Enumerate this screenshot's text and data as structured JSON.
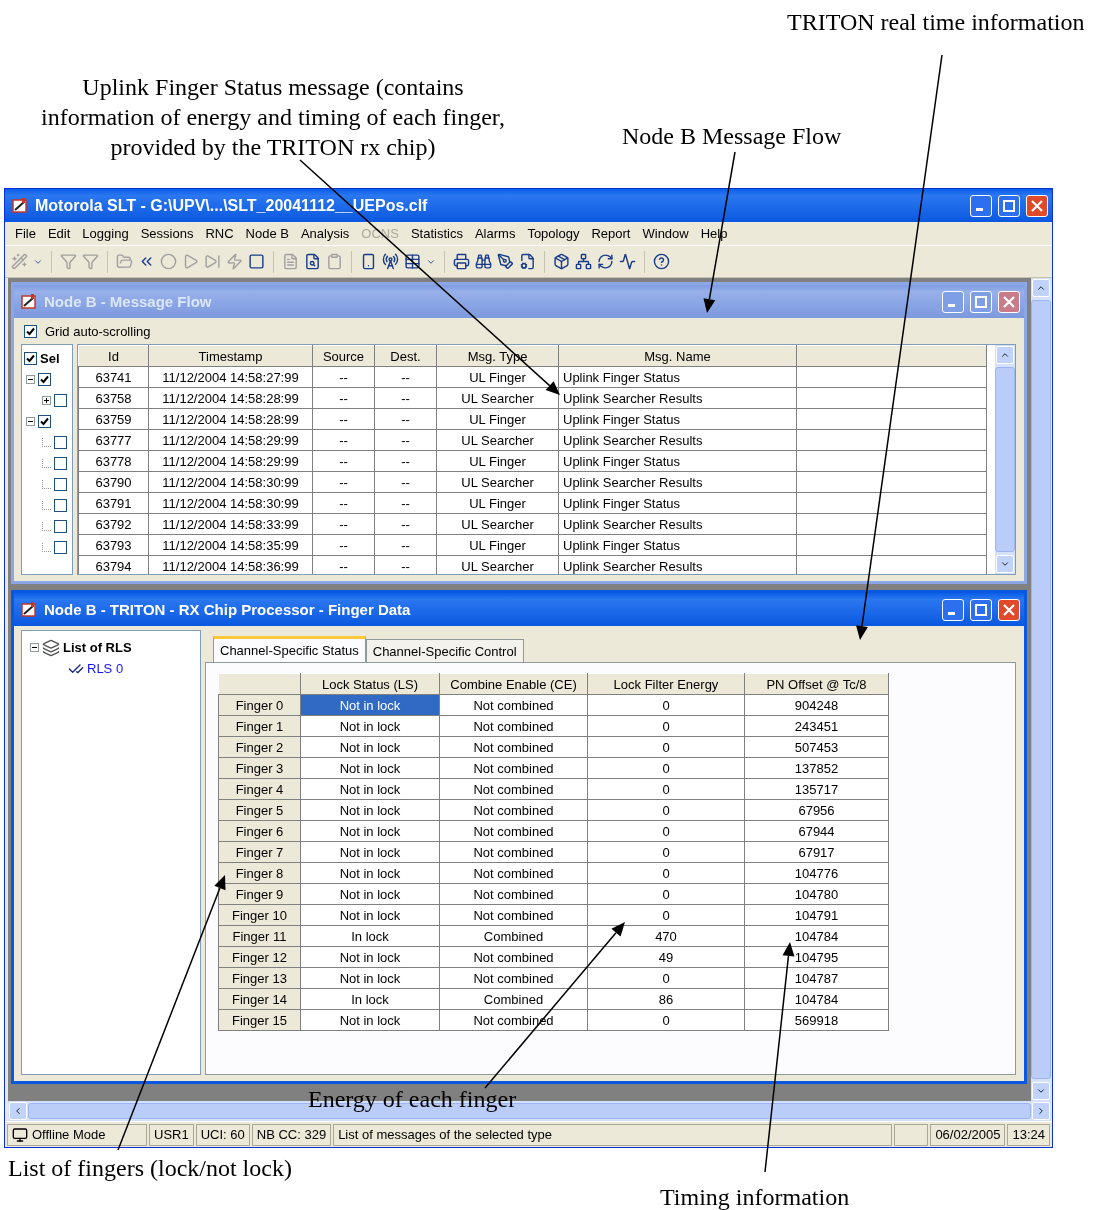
{
  "annotations": [
    {
      "text": "Uplink Finger Status message (contains\ninformation of energy and timing of each finger,\nprovided by the TRITON rx chip)"
    },
    {
      "text": "Node B Message Flow"
    },
    {
      "text": "TRITON real time information"
    },
    {
      "text": "Energy of each finger"
    },
    {
      "text": "List of fingers (lock/not lock)"
    },
    {
      "text": "Timing information"
    }
  ],
  "window": {
    "title": "Motorola SLT - G:\\UPV\\...\\SLT_20041112__UEPos.clf",
    "active": true
  },
  "menu": [
    {
      "label": "File",
      "disabled": false
    },
    {
      "label": "Edit",
      "disabled": false
    },
    {
      "label": "Logging",
      "disabled": false
    },
    {
      "label": "Sessions",
      "disabled": false
    },
    {
      "label": "RNC",
      "disabled": false
    },
    {
      "label": "Node B",
      "disabled": false
    },
    {
      "label": "Analysis",
      "disabled": false
    },
    {
      "label": "OCNS",
      "disabled": true
    },
    {
      "label": "Statistics",
      "disabled": false
    },
    {
      "label": "Alarms",
      "disabled": false
    },
    {
      "label": "Topology",
      "disabled": false
    },
    {
      "label": "Report",
      "disabled": false
    },
    {
      "label": "Window",
      "disabled": false
    },
    {
      "label": "Help",
      "disabled": false
    }
  ],
  "message_flow": {
    "title": "Node B - Message Flow",
    "active": false,
    "auto_scroll": {
      "label": "Grid auto-scrolling",
      "checked": true
    },
    "tree": {
      "header": {
        "label": "Sel",
        "checked": true
      },
      "items": [
        {
          "checked": true,
          "expanded": true,
          "children": [
            {
              "checked": false,
              "expanded": false
            }
          ]
        },
        {
          "checked": true,
          "expanded": true,
          "children": [
            {
              "checked": false
            },
            {
              "checked": false
            },
            {
              "checked": false
            },
            {
              "checked": false
            },
            {
              "checked": false
            },
            {
              "checked": false
            }
          ]
        }
      ]
    },
    "columns": [
      "Id",
      "Timestamp",
      "Source",
      "Dest.",
      "Msg. Type",
      "Msg. Name"
    ],
    "rows": [
      [
        "63741",
        "11/12/2004 14:58:27:99",
        "--",
        "--",
        "UL Finger",
        "Uplink Finger Status"
      ],
      [
        "63758",
        "11/12/2004 14:58:28:99",
        "--",
        "--",
        "UL Searcher",
        "Uplink Searcher Results"
      ],
      [
        "63759",
        "11/12/2004 14:58:28:99",
        "--",
        "--",
        "UL Finger",
        "Uplink Finger Status"
      ],
      [
        "63777",
        "11/12/2004 14:58:29:99",
        "--",
        "--",
        "UL Searcher",
        "Uplink Searcher Results"
      ],
      [
        "63778",
        "11/12/2004 14:58:29:99",
        "--",
        "--",
        "UL Finger",
        "Uplink Finger Status"
      ],
      [
        "63790",
        "11/12/2004 14:58:30:99",
        "--",
        "--",
        "UL Searcher",
        "Uplink Searcher Results"
      ],
      [
        "63791",
        "11/12/2004 14:58:30:99",
        "--",
        "--",
        "UL Finger",
        "Uplink Finger Status"
      ],
      [
        "63792",
        "11/12/2004 14:58:33:99",
        "--",
        "--",
        "UL Searcher",
        "Uplink Searcher Results"
      ],
      [
        "63793",
        "11/12/2004 14:58:35:99",
        "--",
        "--",
        "UL Finger",
        "Uplink Finger Status"
      ],
      [
        "63794",
        "11/12/2004 14:58:36:99",
        "--",
        "--",
        "UL Searcher",
        "Uplink Searcher Results"
      ]
    ]
  },
  "finger_data": {
    "title": "Node B - TRITON - RX Chip Processor - Finger Data",
    "active": true,
    "tree": {
      "label": "List of RLS",
      "expanded": true,
      "children": [
        {
          "label": "RLS 0"
        }
      ]
    },
    "tabs": [
      {
        "label": "Channel-Specific Status",
        "selected": true
      },
      {
        "label": "Channel-Specific Control",
        "selected": false
      }
    ],
    "columns": [
      "Lock Status (LS)",
      "Combine Enable (CE)",
      "Lock Filter Energy",
      "PN Offset @ Tc/8"
    ],
    "rows": [
      {
        "finger": "Finger 0",
        "selected": true,
        "cells": [
          "Not in lock",
          "Not combined",
          "0",
          "904248"
        ]
      },
      {
        "finger": "Finger 1",
        "selected": false,
        "cells": [
          "Not in lock",
          "Not combined",
          "0",
          "243451"
        ]
      },
      {
        "finger": "Finger 2",
        "selected": false,
        "cells": [
          "Not in lock",
          "Not combined",
          "0",
          "507453"
        ]
      },
      {
        "finger": "Finger 3",
        "selected": false,
        "cells": [
          "Not in lock",
          "Not combined",
          "0",
          "137852"
        ]
      },
      {
        "finger": "Finger 4",
        "selected": false,
        "cells": [
          "Not in lock",
          "Not combined",
          "0",
          "135717"
        ]
      },
      {
        "finger": "Finger 5",
        "selected": false,
        "cells": [
          "Not in lock",
          "Not combined",
          "0",
          "67956"
        ]
      },
      {
        "finger": "Finger 6",
        "selected": false,
        "cells": [
          "Not in lock",
          "Not combined",
          "0",
          "67944"
        ]
      },
      {
        "finger": "Finger 7",
        "selected": false,
        "cells": [
          "Not in lock",
          "Not combined",
          "0",
          "67917"
        ]
      },
      {
        "finger": "Finger 8",
        "selected": false,
        "cells": [
          "Not in lock",
          "Not combined",
          "0",
          "104776"
        ]
      },
      {
        "finger": "Finger 9",
        "selected": false,
        "cells": [
          "Not in lock",
          "Not combined",
          "0",
          "104780"
        ]
      },
      {
        "finger": "Finger 10",
        "selected": false,
        "cells": [
          "Not in lock",
          "Not combined",
          "0",
          "104791"
        ]
      },
      {
        "finger": "Finger 11",
        "selected": false,
        "cells": [
          "In lock",
          "Combined",
          "470",
          "104784"
        ]
      },
      {
        "finger": "Finger 12",
        "selected": false,
        "cells": [
          "Not in lock",
          "Not combined",
          "49",
          "104795"
        ]
      },
      {
        "finger": "Finger 13",
        "selected": false,
        "cells": [
          "Not in lock",
          "Not combined",
          "0",
          "104787"
        ]
      },
      {
        "finger": "Finger 14",
        "selected": false,
        "cells": [
          "In lock",
          "Combined",
          "86",
          "104784"
        ]
      },
      {
        "finger": "Finger 15",
        "selected": false,
        "cells": [
          "Not in lock",
          "Not combined",
          "0",
          "569918"
        ]
      }
    ]
  },
  "status_bar": {
    "mode": "Offline Mode",
    "panes": [
      "USR1",
      "UCI: 60",
      "NB CC: 329",
      "List of messages of the selected type"
    ],
    "date": "06/02/2005",
    "time": "13:24"
  }
}
